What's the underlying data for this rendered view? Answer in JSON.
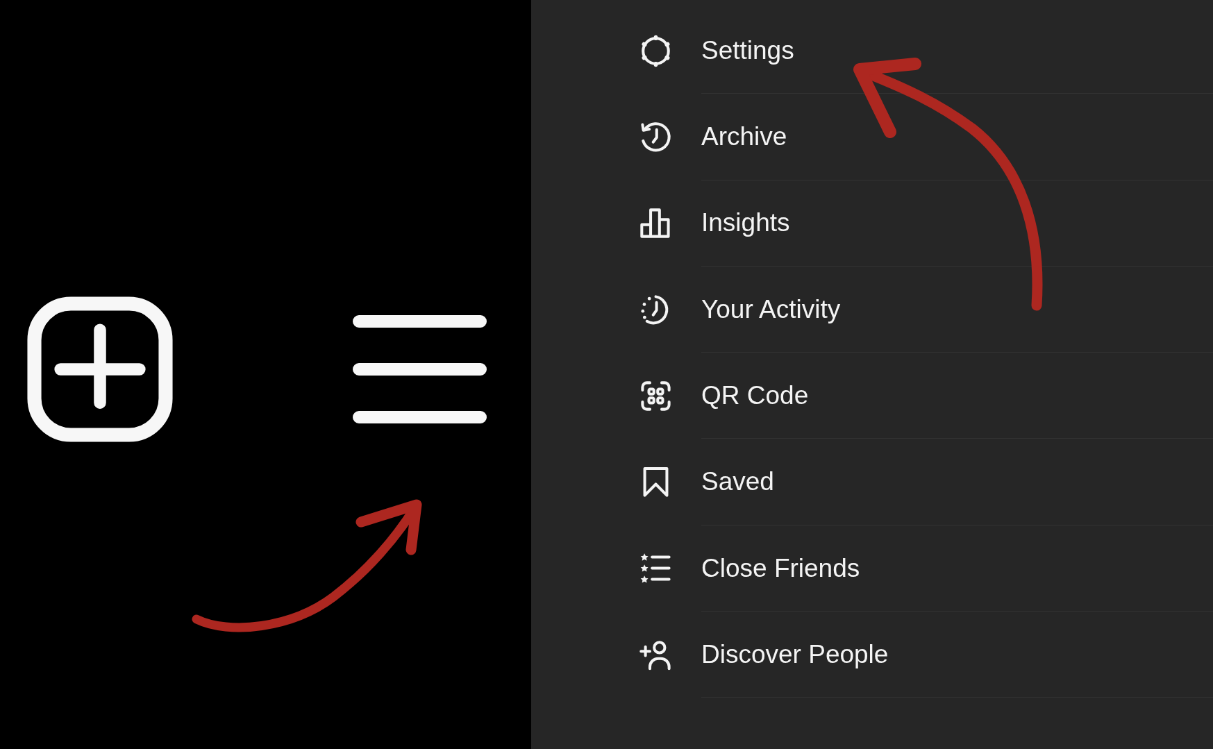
{
  "menu": {
    "items": [
      {
        "label": "Settings"
      },
      {
        "label": "Archive"
      },
      {
        "label": "Insights"
      },
      {
        "label": "Your Activity"
      },
      {
        "label": "QR Code"
      },
      {
        "label": "Saved"
      },
      {
        "label": "Close Friends"
      },
      {
        "label": "Discover People"
      }
    ]
  }
}
